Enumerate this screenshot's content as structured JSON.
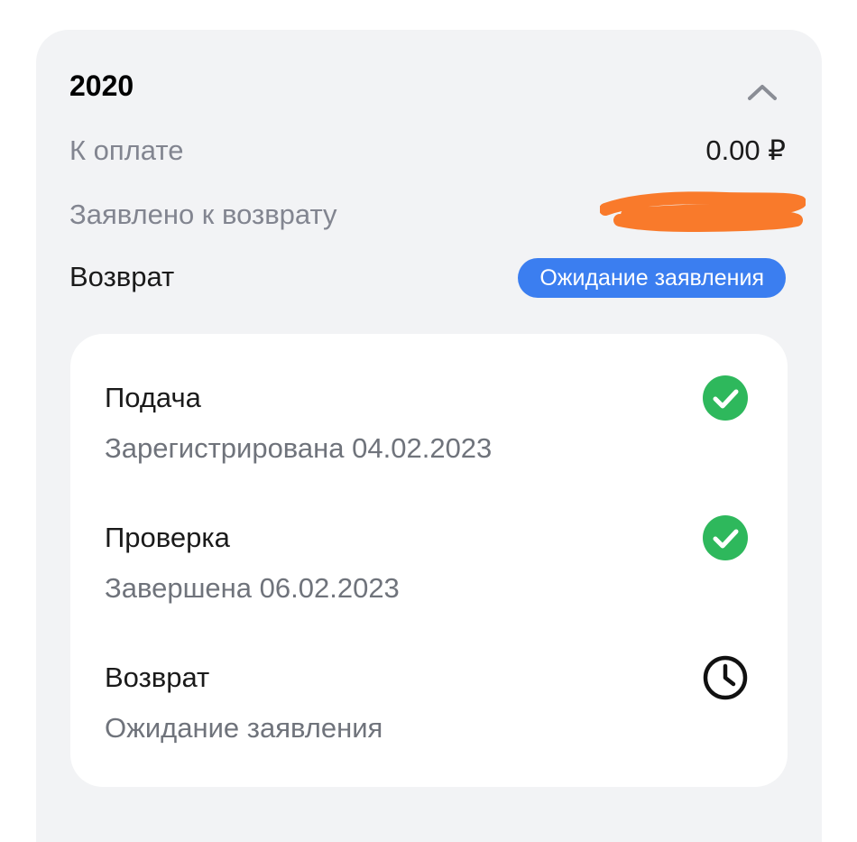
{
  "summary": {
    "year": "2020",
    "to_pay_label": "К оплате",
    "to_pay_value": "0.00 ₽",
    "claimed_label": "Заявлено к возврату",
    "refund_label": "Возврат",
    "refund_status": "Ожидание заявления"
  },
  "steps": [
    {
      "title": "Подача",
      "subtitle": "Зарегистрирована 04.02.2023",
      "icon": "check-circle-icon"
    },
    {
      "title": "Проверка",
      "subtitle": "Завершена 06.02.2023",
      "icon": "check-circle-icon"
    },
    {
      "title": "Возврат",
      "subtitle": "Ожидание заявления",
      "icon": "clock-icon"
    }
  ],
  "colors": {
    "card_background": "#f2f3f5",
    "badge_blue": "#3b7ef0",
    "check_green": "#2eb85c",
    "redaction_orange": "#f97a2b",
    "secondary_text": "#828590"
  }
}
